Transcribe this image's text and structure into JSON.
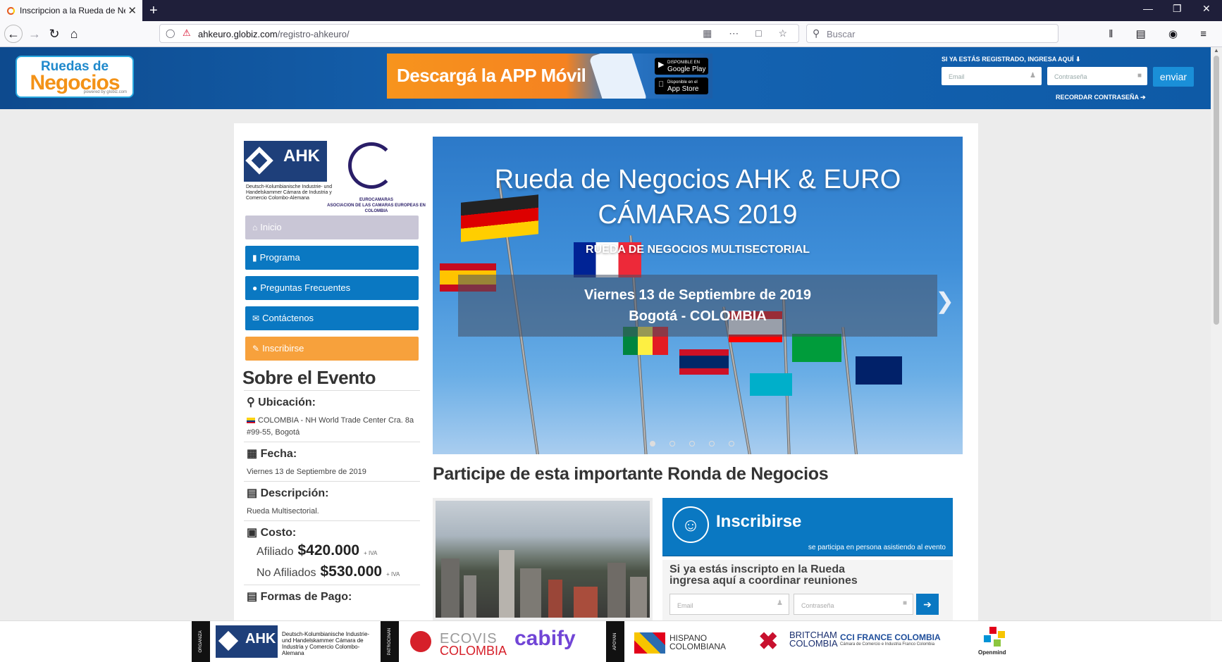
{
  "browser": {
    "tab_title": "Inscripcion a la Rueda de Nego",
    "url_host": "ahkeuro.globiz.com",
    "url_path": "/registro-ahkeuro/",
    "search_placeholder": "Buscar",
    "new_tab": "+",
    "close_tab": "✕"
  },
  "header": {
    "logo_line1": "Ruedas de",
    "logo_line2": "Negocios",
    "logo_tag": "powered by globiz.com",
    "app_banner_text": "Descargá la APP Móvil",
    "google_play_small": "DISPONIBLE EN",
    "google_play": "Google Play",
    "app_store_small": "Disponible en el",
    "app_store": "App Store",
    "login_title": "SI YA ESTÁS REGISTRADO, INGRESA AQUÍ ⬇",
    "email_placeholder": "Email",
    "password_placeholder": "Contraseña",
    "submit": "enviar",
    "remember": "RECORDAR CONTRASEÑA ➔"
  },
  "sidebar": {
    "ahk_logo": "AHK",
    "ahk_caption": "Deutsch-Kolumbianische Industrie- und Handelskammer Cámara de Industria y Comercio Colombo-Alemana",
    "euro_caption_title": "EUROCAMARAS",
    "euro_caption_sub": "ASOCIACION DE LAS CAMARAS EUROPEAS EN COLOMBIA",
    "menu": [
      {
        "label": "Inicio",
        "icon": "home-icon"
      },
      {
        "label": "Programa",
        "icon": "file-icon"
      },
      {
        "label": "Preguntas Frecuentes",
        "icon": "comments-icon"
      },
      {
        "label": "Contáctenos",
        "icon": "envelope-icon"
      },
      {
        "label": "Inscribirse",
        "icon": "edit-icon"
      }
    ],
    "about_title": "Sobre el Evento",
    "location_label": "Ubicación:",
    "location_value": "COLOMBIA - NH World Trade Center Cra. 8a #99-55, Bogotá",
    "date_label": "Fecha:",
    "date_value": "Viernes 13 de Septiembre de 2019",
    "description_label": "Descripción:",
    "description_value": "Rueda Multisectorial.",
    "cost_label": "Costo:",
    "cost_affiliate_label": "Afiliado",
    "cost_affiliate_value": "$420.000",
    "cost_non_affiliate_label": "No Afiliados",
    "cost_non_affiliate_value": "$530.000",
    "iva": "+ IVA",
    "payment_label": "Formas de Pago:"
  },
  "slider": {
    "title_line1": "Rueda de Negocios AHK & EURO",
    "title_line2": "CÁMARAS 2019",
    "subtitle": "RUEDA DE NEGOCIOS MULTISECTORIAL",
    "date": "Viernes 13 de Septiembre de 2019",
    "city": "Bogotá - COLOMBIA",
    "slide_count": 5,
    "active_slide": 1
  },
  "main": {
    "participe_title": "Participe de esta importante Ronda de Negocios",
    "inscribirse_title": "Inscribirse",
    "inscribirse_sub": "se participa en persona asistiendo al evento",
    "coordinar_title_line1": "Si ya estás inscripto en la Rueda",
    "coordinar_title_line2": "ingresa aquí a coordinar reuniones",
    "coord_email_placeholder": "Email",
    "coord_password_placeholder": "Contraseña"
  },
  "footer": {
    "organiza": "ORGANIZA",
    "patrocinan": "PATROCINAN",
    "apoyan": "APOYAN",
    "ahk": "AHK",
    "ahk_caption": "Deutsch-Kolumbianische Industrie- und Handelskammer Cámara de Industria y Comercio Colombo-Alemana",
    "ecovis_1": "ECOVIS",
    "ecovis_2": "COLOMBIA",
    "cabify": "cabify",
    "hispano_1": "HISPANO",
    "hispano_2": "COLOMBIANA",
    "britcham_1": "BRITCHAM",
    "britcham_2": "COLOMBIA",
    "cci": "CCI FRANCE COLOMBIA",
    "cci_sub": "Cámara de Comercio e Industria Franco Colombia",
    "openmind": "Openmind"
  },
  "colors": {
    "primary_blue": "#0a78c2",
    "orange": "#f7a13c",
    "header_blue": "#1665b4",
    "menu_home": "#c9c6d6"
  }
}
